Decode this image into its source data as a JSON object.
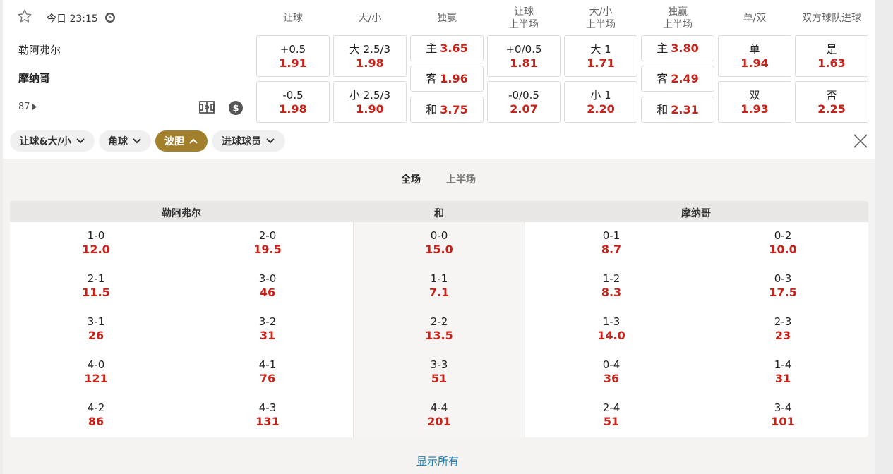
{
  "match": {
    "time": "今日 23:15",
    "home": "勒阿弗尔",
    "away": "摩纳哥",
    "minute": "87"
  },
  "headers": {
    "h1": "让球",
    "h2": "大/小",
    "h3": "独赢",
    "h4a": "让球",
    "h4b": "上半场",
    "h5a": "大/小",
    "h5b": "上半场",
    "h6a": "独赢",
    "h6b": "上半场",
    "h7": "单/双",
    "h8": "双方球队进球"
  },
  "odds": {
    "hcp_home_line": "+0.5",
    "hcp_home_odd": "1.91",
    "hcp_away_line": "-0.5",
    "hcp_away_odd": "1.98",
    "ou_over_line": "大 2.5/3",
    "ou_over_odd": "1.98",
    "ou_under_line": "小 2.5/3",
    "ou_under_odd": "1.90",
    "ml_home_lbl": "主",
    "ml_home_odd": "3.65",
    "ml_away_lbl": "客",
    "ml_away_odd": "1.96",
    "ml_draw_lbl": "和",
    "ml_draw_odd": "3.75",
    "hhcp_home_line": "+0/0.5",
    "hhcp_home_odd": "1.81",
    "hhcp_away_line": "-0/0.5",
    "hhcp_away_odd": "2.07",
    "hou_over_line": "大 1",
    "hou_over_odd": "1.71",
    "hou_under_line": "小 1",
    "hou_under_odd": "2.20",
    "hml_home_lbl": "主",
    "hml_home_odd": "3.80",
    "hml_away_lbl": "客",
    "hml_away_odd": "2.49",
    "hml_draw_lbl": "和",
    "hml_draw_odd": "2.31",
    "oe_odd_lbl": "单",
    "oe_odd_odd": "1.94",
    "oe_even_lbl": "双",
    "oe_even_odd": "1.93",
    "btts_yes_lbl": "是",
    "btts_yes_odd": "1.63",
    "btts_no_lbl": "否",
    "btts_no_odd": "2.25"
  },
  "filters": {
    "f1": "让球&大/小",
    "f2": "角球",
    "f3": "波胆",
    "f4": "进球球员"
  },
  "periods": {
    "full": "全场",
    "half": "上半场"
  },
  "correct_score": {
    "home_header": "勒阿弗尔",
    "draw_header": "和",
    "away_header": "摩纳哥",
    "home": [
      {
        "score": "1-0",
        "odd": "12.0"
      },
      {
        "score": "2-0",
        "odd": "19.5"
      },
      {
        "score": "2-1",
        "odd": "11.5"
      },
      {
        "score": "3-0",
        "odd": "46"
      },
      {
        "score": "3-1",
        "odd": "26"
      },
      {
        "score": "3-2",
        "odd": "31"
      },
      {
        "score": "4-0",
        "odd": "121"
      },
      {
        "score": "4-1",
        "odd": "76"
      },
      {
        "score": "4-2",
        "odd": "86"
      },
      {
        "score": "4-3",
        "odd": "131"
      }
    ],
    "draw": [
      {
        "score": "0-0",
        "odd": "15.0"
      },
      {
        "score": "1-1",
        "odd": "7.1"
      },
      {
        "score": "2-2",
        "odd": "13.5"
      },
      {
        "score": "3-3",
        "odd": "51"
      },
      {
        "score": "4-4",
        "odd": "201"
      }
    ],
    "away": [
      {
        "score": "0-1",
        "odd": "8.7"
      },
      {
        "score": "0-2",
        "odd": "10.0"
      },
      {
        "score": "1-2",
        "odd": "8.3"
      },
      {
        "score": "0-3",
        "odd": "17.5"
      },
      {
        "score": "1-3",
        "odd": "14.0"
      },
      {
        "score": "2-3",
        "odd": "23"
      },
      {
        "score": "0-4",
        "odd": "36"
      },
      {
        "score": "1-4",
        "odd": "31"
      },
      {
        "score": "2-4",
        "odd": "51"
      },
      {
        "score": "3-4",
        "odd": "101"
      }
    ]
  },
  "footer": {
    "show_all": "显示所有"
  },
  "colors": {
    "odd": "#c8231a",
    "active_chip": "#a2802b",
    "link": "#1d7fb8"
  }
}
